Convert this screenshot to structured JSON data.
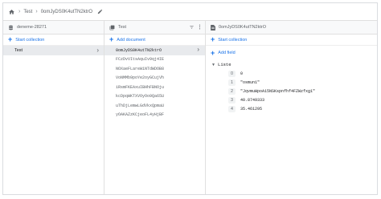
{
  "breadcrumb": {
    "project": "deneme-28271",
    "collection": "Test",
    "document": "0omJyDS0K4utTN2ktrO"
  },
  "columns": {
    "root": {
      "title": "deneme-28271",
      "add_label": "Start collection",
      "items": [
        {
          "label": "Test",
          "selected": true
        }
      ]
    },
    "collection": {
      "title": "Test",
      "add_label": "Add document",
      "items": [
        {
          "label": "0omJyDS0K4utTN2ktrO",
          "selected": true
        },
        {
          "label": "FCzDvVItsAquIv9qj4IE",
          "selected": false
        },
        {
          "label": "NOXaeFLareW1NTdWDOB8",
          "selected": false
        },
        {
          "label": "VoNMMb9poYe2oyGCujVh",
          "selected": false
        },
        {
          "label": "iRsmFKEAxuIBHhFBNOju",
          "selected": false
        },
        {
          "label": "kcDpqWKTXVOyOo9Qa65U",
          "selected": false
        },
        {
          "label": "uThDjLemwLGdVkxQpmaU",
          "selected": false
        },
        {
          "label": "yOAKAZzKCjeoFL4yHjBF",
          "selected": false
        }
      ]
    },
    "document": {
      "title": "0omJyDS0K4utTN2ktrO",
      "add_collection_label": "Start collection",
      "add_field_label": "Add field",
      "field_name": "Liste",
      "items": [
        {
          "index": "0",
          "value": "0"
        },
        {
          "index": "1",
          "value": "\"osmun1\""
        },
        {
          "index": "2",
          "value": "\"JqvmuWpoA15NSKspnfhf4FZWzfxg1\""
        },
        {
          "index": "3",
          "value": "40.8749333"
        },
        {
          "index": "4",
          "value": "35.461295"
        }
      ]
    }
  },
  "colors": {
    "accent": "#1a73e8",
    "selected_row": "#e8eaed",
    "border": "#e0e0e0"
  },
  "icons": [
    "home-icon",
    "chevron-right-icon",
    "edit-icon",
    "database-icon",
    "collection-icon",
    "filter-icon",
    "more-vert-icon",
    "document-icon",
    "add-icon",
    "caret-down-icon"
  ]
}
